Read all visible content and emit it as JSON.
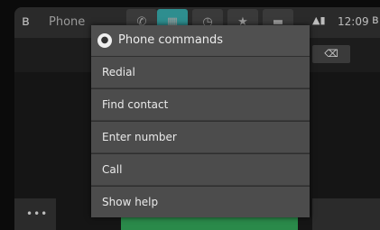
{
  "status_bar": {
    "app_name": "Phone",
    "clock": "12:09",
    "signal": "▲▮",
    "bluetooth_icon": "bluetooth-icon"
  },
  "tabs": [
    {
      "name": "phone-tab",
      "icon": "✆"
    },
    {
      "name": "keypad-tab",
      "icon": "▦",
      "active": true
    },
    {
      "name": "recent-tab",
      "icon": "◷"
    },
    {
      "name": "favorites-tab",
      "icon": "★"
    },
    {
      "name": "contacts-tab",
      "icon": "▬"
    }
  ],
  "background": {
    "backspace_label": "⌫",
    "more_label": "•••"
  },
  "popup": {
    "title": "Phone commands",
    "mic_icon": "🎙",
    "items": [
      {
        "label": "Redial"
      },
      {
        "label": "Find contact"
      },
      {
        "label": "Enter number"
      },
      {
        "label": "Call"
      },
      {
        "label": "Show help"
      }
    ]
  },
  "colors": {
    "accent": "#2e8e8f",
    "call_green": "#2a8a4a",
    "popup_bg": "#4c4c4c"
  }
}
